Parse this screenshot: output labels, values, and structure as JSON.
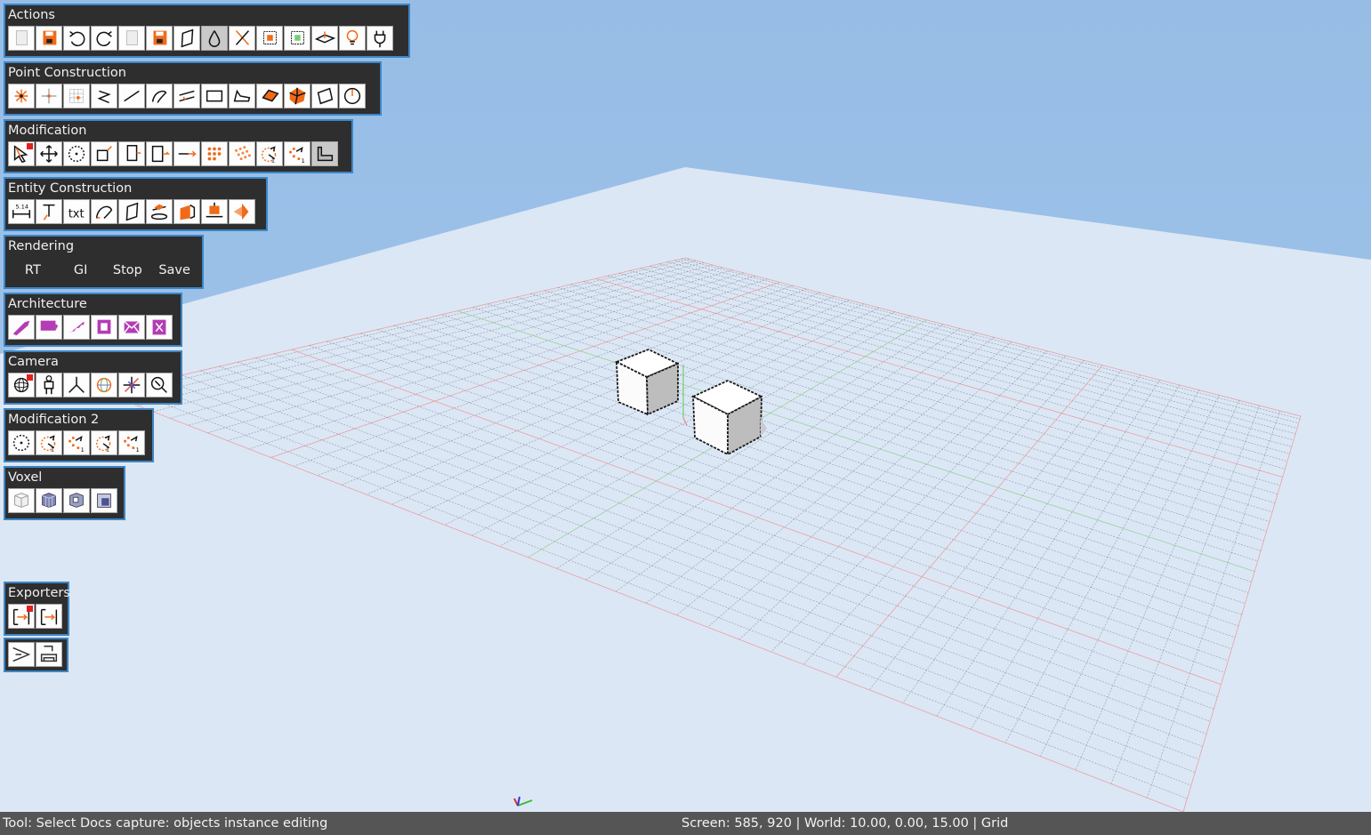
{
  "colors": {
    "sky": "#9bbfe6",
    "ground": "#dce7f5",
    "panel_bg": "#2e2e2e",
    "panel_border": "#3d86c6",
    "statusbar_bg": "#555555",
    "accent_orange": "#f06a18",
    "accent_magenta": "#b43cb4"
  },
  "toolbars": {
    "actions": {
      "title": "Actions",
      "icons": [
        "new-file-icon",
        "save-icon",
        "undo-icon",
        "redo-icon",
        "blank-page-icon",
        "save-as-icon",
        "face-icon",
        "drop-icon",
        "delete-cross-icon",
        "select-box-icon",
        "select-box-green-icon",
        "plane-icon",
        "light-bulb-icon",
        "plug-icon"
      ]
    },
    "point_construction": {
      "title": "Point Construction",
      "icons": [
        "point-star-icon",
        "point-axis-icon",
        "point-grid-icon",
        "zigzag-icon",
        "line-icon",
        "arc-icon",
        "parallel-lines-icon",
        "rectangle-icon",
        "polygon-icon",
        "filled-quad-icon",
        "mesh-icon",
        "quad-outline-icon",
        "circle-clock-icon"
      ]
    },
    "modification": {
      "title": "Modification",
      "icons": [
        "select-arrow-icon",
        "move-icon",
        "rotate-icon",
        "scale-icon",
        "extrude-icon",
        "push-pull-icon",
        "offset-icon",
        "array-dots-icon",
        "array-grid-icon",
        "rotate-copy-icon",
        "mirror-copy-icon",
        "profile-icon"
      ]
    },
    "entity_construction": {
      "title": "Entity Construction",
      "icons": [
        "dimension-icon",
        "text-tool-icon",
        "text-txt-icon",
        "curve-icon",
        "face-plane-icon",
        "section-icon",
        "paint-icon",
        "stamp-icon",
        "intersect-icon"
      ]
    },
    "rendering": {
      "title": "Rendering",
      "buttons": [
        "RT",
        "GI",
        "Stop",
        "Save"
      ]
    },
    "architecture": {
      "title": "Architecture",
      "icons": [
        "wall-icon",
        "slab-icon",
        "stair-icon",
        "window-icon",
        "envelope-icon",
        "door-icon"
      ]
    },
    "camera": {
      "title": "Camera",
      "icons": [
        "orbit-icon",
        "walk-person-icon",
        "axes-icon",
        "globe-icon",
        "axis-cross-icon",
        "zoom-icon"
      ]
    },
    "modification_2": {
      "title": "Modification 2",
      "icons": [
        "rotate-icon",
        "rotate-copy-icon",
        "mirror-copy-icon",
        "rotate-copy-icon",
        "mirror-copy-icon"
      ]
    },
    "voxel": {
      "title": "Voxel",
      "icons": [
        "voxel-grid-icon",
        "voxel-cube-icon",
        "voxel-cut-icon",
        "voxel-fill-icon"
      ]
    },
    "exporters": {
      "title": "Exporters",
      "icons": [
        "export-icon",
        "export-alt-icon"
      ]
    },
    "extra": {
      "icons": [
        "funnel-icon",
        "printer-icon"
      ]
    }
  },
  "statusbar": {
    "left": "Tool: Select Docs capture: objects instance editing",
    "right": "Screen: 585, 920 | World: 10.00, 0.00, 15.00 | Grid"
  }
}
